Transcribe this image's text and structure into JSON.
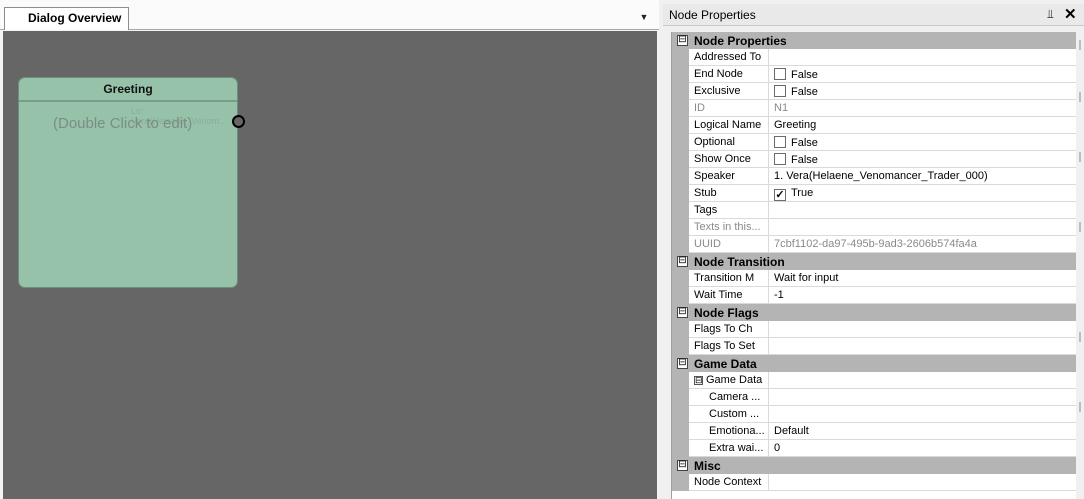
{
  "document_tab": {
    "title": "Dialog Overview"
  },
  "node": {
    "title": "Greeting",
    "hint": "(Double Click to edit)",
    "ghost_text": "Lo: Vera(Helaene_Venom..."
  },
  "properties_panel": {
    "title": "Node Properties",
    "rows": [
      {
        "kind": "section",
        "label": "Node Properties",
        "expander": "⊟"
      },
      {
        "kind": "prop",
        "name": "Addressed To",
        "value": ""
      },
      {
        "kind": "prop",
        "name": "End Node",
        "value": "False",
        "checkbox": "unchecked"
      },
      {
        "kind": "prop",
        "name": "Exclusive",
        "value": "False",
        "checkbox": "unchecked"
      },
      {
        "kind": "prop",
        "name": "ID",
        "value": "N1",
        "disabled": true
      },
      {
        "kind": "prop",
        "name": "Logical Name",
        "value": "Greeting"
      },
      {
        "kind": "prop",
        "name": "Optional",
        "value": "False",
        "checkbox": "unchecked"
      },
      {
        "kind": "prop",
        "name": "Show Once",
        "value": "False",
        "checkbox": "unchecked"
      },
      {
        "kind": "prop",
        "name": "Speaker",
        "value": "1. Vera(Helaene_Venomancer_Trader_000)"
      },
      {
        "kind": "prop",
        "name": "Stub",
        "value": "True",
        "checkbox": "checked"
      },
      {
        "kind": "prop",
        "name": "Tags",
        "value": ""
      },
      {
        "kind": "prop",
        "name": "Texts in this...",
        "value": "",
        "disabled": true
      },
      {
        "kind": "prop",
        "name": "UUID",
        "value": "7cbf1102-da97-495b-9ad3-2606b574fa4a",
        "disabled": true
      },
      {
        "kind": "section",
        "label": "Node Transition",
        "expander": "⊟"
      },
      {
        "kind": "prop",
        "name": "Transition M",
        "value": "Wait for input"
      },
      {
        "kind": "prop",
        "name": "Wait Time",
        "value": "-1"
      },
      {
        "kind": "section",
        "label": "Node Flags",
        "expander": "⊟"
      },
      {
        "kind": "prop",
        "name": "Flags To Ch",
        "value": ""
      },
      {
        "kind": "prop",
        "name": "Flags To Set",
        "value": ""
      },
      {
        "kind": "section",
        "label": "Game Data",
        "expander": "⊟"
      },
      {
        "kind": "prop",
        "name": "Game Data",
        "value": "",
        "sub_expander": "⊟"
      },
      {
        "kind": "prop",
        "name": "Camera ...",
        "value": "",
        "nested": true
      },
      {
        "kind": "prop",
        "name": "Custom ...",
        "value": "",
        "nested": true
      },
      {
        "kind": "prop",
        "name": "Emotiona...",
        "value": "Default",
        "nested": true
      },
      {
        "kind": "prop",
        "name": "Extra wai...",
        "value": "0",
        "nested": true
      },
      {
        "kind": "section",
        "label": "Misc",
        "expander": "⊟"
      },
      {
        "kind": "prop",
        "name": "Node Context",
        "value": ""
      }
    ]
  },
  "icons": {
    "tab_dropdown": "▼",
    "pin": "📌",
    "close": "✕",
    "checkmark": "✓"
  },
  "colors": {
    "canvas": "#666666",
    "node_fill": "#96c2aa",
    "section_gray": "#b4b4b4"
  }
}
